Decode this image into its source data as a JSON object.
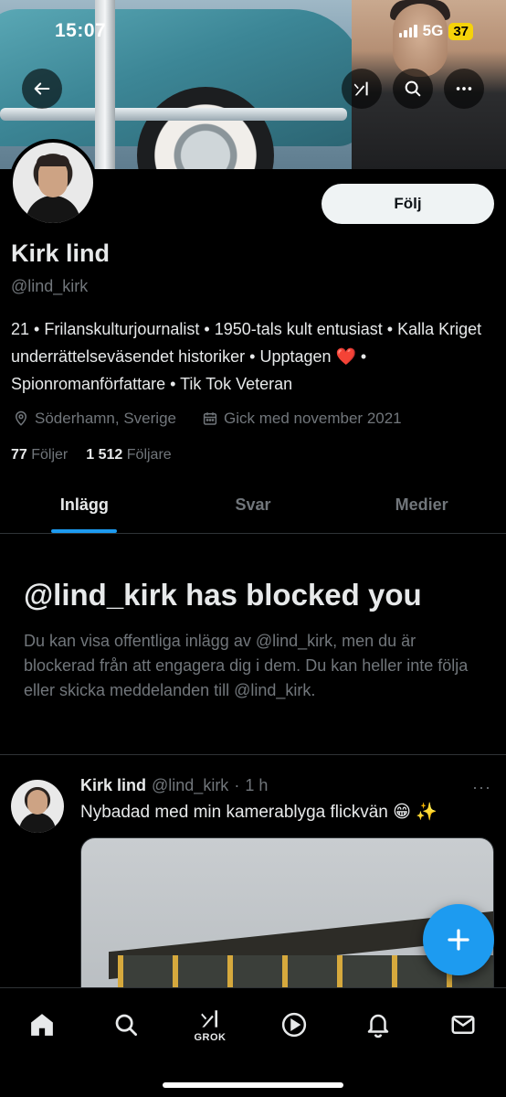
{
  "status_bar": {
    "time": "15:07",
    "network": "5G",
    "battery": "37"
  },
  "header": {
    "back_icon": "arrow-left-icon",
    "grok_icon": "grok-icon",
    "search_icon": "search-icon",
    "more_icon": "more-horizontal-icon"
  },
  "profile": {
    "follow_label": "Följ",
    "name": "Kirk lind",
    "handle": "@lind_kirk",
    "bio": "21 • Frilanskulturjournalist • 1950-tals kult entusiast • Kalla Kriget underrättelseväsendet historiker • Upptagen ❤️ • Spionromanförfattare • Tik Tok Veteran",
    "location": "Söderhamn, Sverige",
    "joined": "Gick med november 2021",
    "following_count": "77",
    "following_label": "Följer",
    "followers_count": "1 512",
    "followers_label": "Följare"
  },
  "tabs": [
    {
      "label": "Inlägg",
      "active": true
    },
    {
      "label": "Svar",
      "active": false
    },
    {
      "label": "Medier",
      "active": false
    }
  ],
  "blocked": {
    "title": "@lind_kirk has blocked you",
    "text": "Du kan visa offentliga inlägg av @lind_kirk, men du är blockerad från att engagera dig i dem. Du kan heller inte följa eller skicka meddelanden till @lind_kirk."
  },
  "post": {
    "name": "Kirk lind",
    "handle": "@lind_kirk",
    "dot": "·",
    "time": "1 h",
    "more": "···",
    "text": "Nybadad med min kamerablyga flickvän 😁 ✨"
  },
  "bottom_nav": {
    "grok_label": "GROK",
    "items": [
      "home-icon",
      "search-icon",
      "grok-icon",
      "play-icon",
      "bell-icon",
      "mail-icon"
    ]
  },
  "colors": {
    "accent": "#1d9bf0",
    "background": "#000000",
    "secondary_text": "#71767b"
  }
}
